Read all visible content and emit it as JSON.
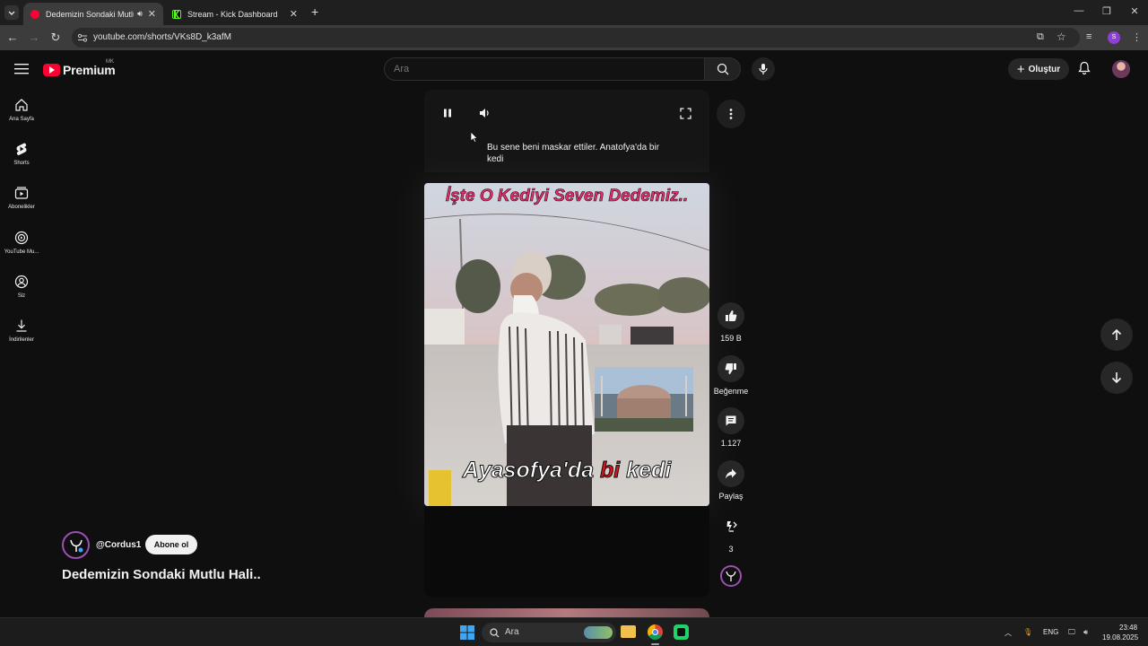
{
  "browser": {
    "tabs": [
      {
        "title": "Dedemizin Sondaki Mutlu Hali..",
        "active": true,
        "favicon_color": "#ff0033"
      },
      {
        "title": "Stream - Kick Dashboard",
        "active": false,
        "favicon_color": "#53fc18"
      }
    ],
    "url": "youtube.com/shorts/VKs8D_k3afM",
    "new_tab": "+"
  },
  "youtube": {
    "logo_text": "Premium",
    "country_code": "MK",
    "search_placeholder": "Ara",
    "create_label": "Oluştur",
    "sidebar": [
      {
        "label": "Ana Sayfa",
        "icon": "home-icon"
      },
      {
        "label": "Shorts",
        "icon": "shorts-icon"
      },
      {
        "label": "Abonelikler",
        "icon": "subscriptions-icon"
      },
      {
        "label": "YouTube Mu...",
        "icon": "youtube-music-icon"
      },
      {
        "label": "Siz",
        "icon": "you-icon"
      },
      {
        "label": "İndirilenler",
        "icon": "downloads-icon"
      }
    ]
  },
  "short": {
    "caption": "Bu sene beni maskar ettiler. Anatofya'da bir kedi",
    "overlay_top": "İşte O Kediyi Seven Dedemiz..",
    "overlay_bottom_parts": [
      "Ayasofya'da ",
      "bi",
      " kedi"
    ],
    "likes": "159 B",
    "dislike_label": "Beğenme",
    "comments": "1.127",
    "share_label": "Paylaş",
    "remix_count": "3",
    "channel": "@Cordus1",
    "subscribe_label": "Abone ol",
    "title": "Dedemizin Sondaki Mutlu Hali.."
  },
  "taskbar": {
    "search_label": "Ara",
    "language": "ENG",
    "time": "23:48",
    "date": "19.08.2025"
  },
  "colors": {
    "accent_red": "#ff0033",
    "overlay_pink": "#e2306f",
    "overlay_red": "#d4141e"
  }
}
